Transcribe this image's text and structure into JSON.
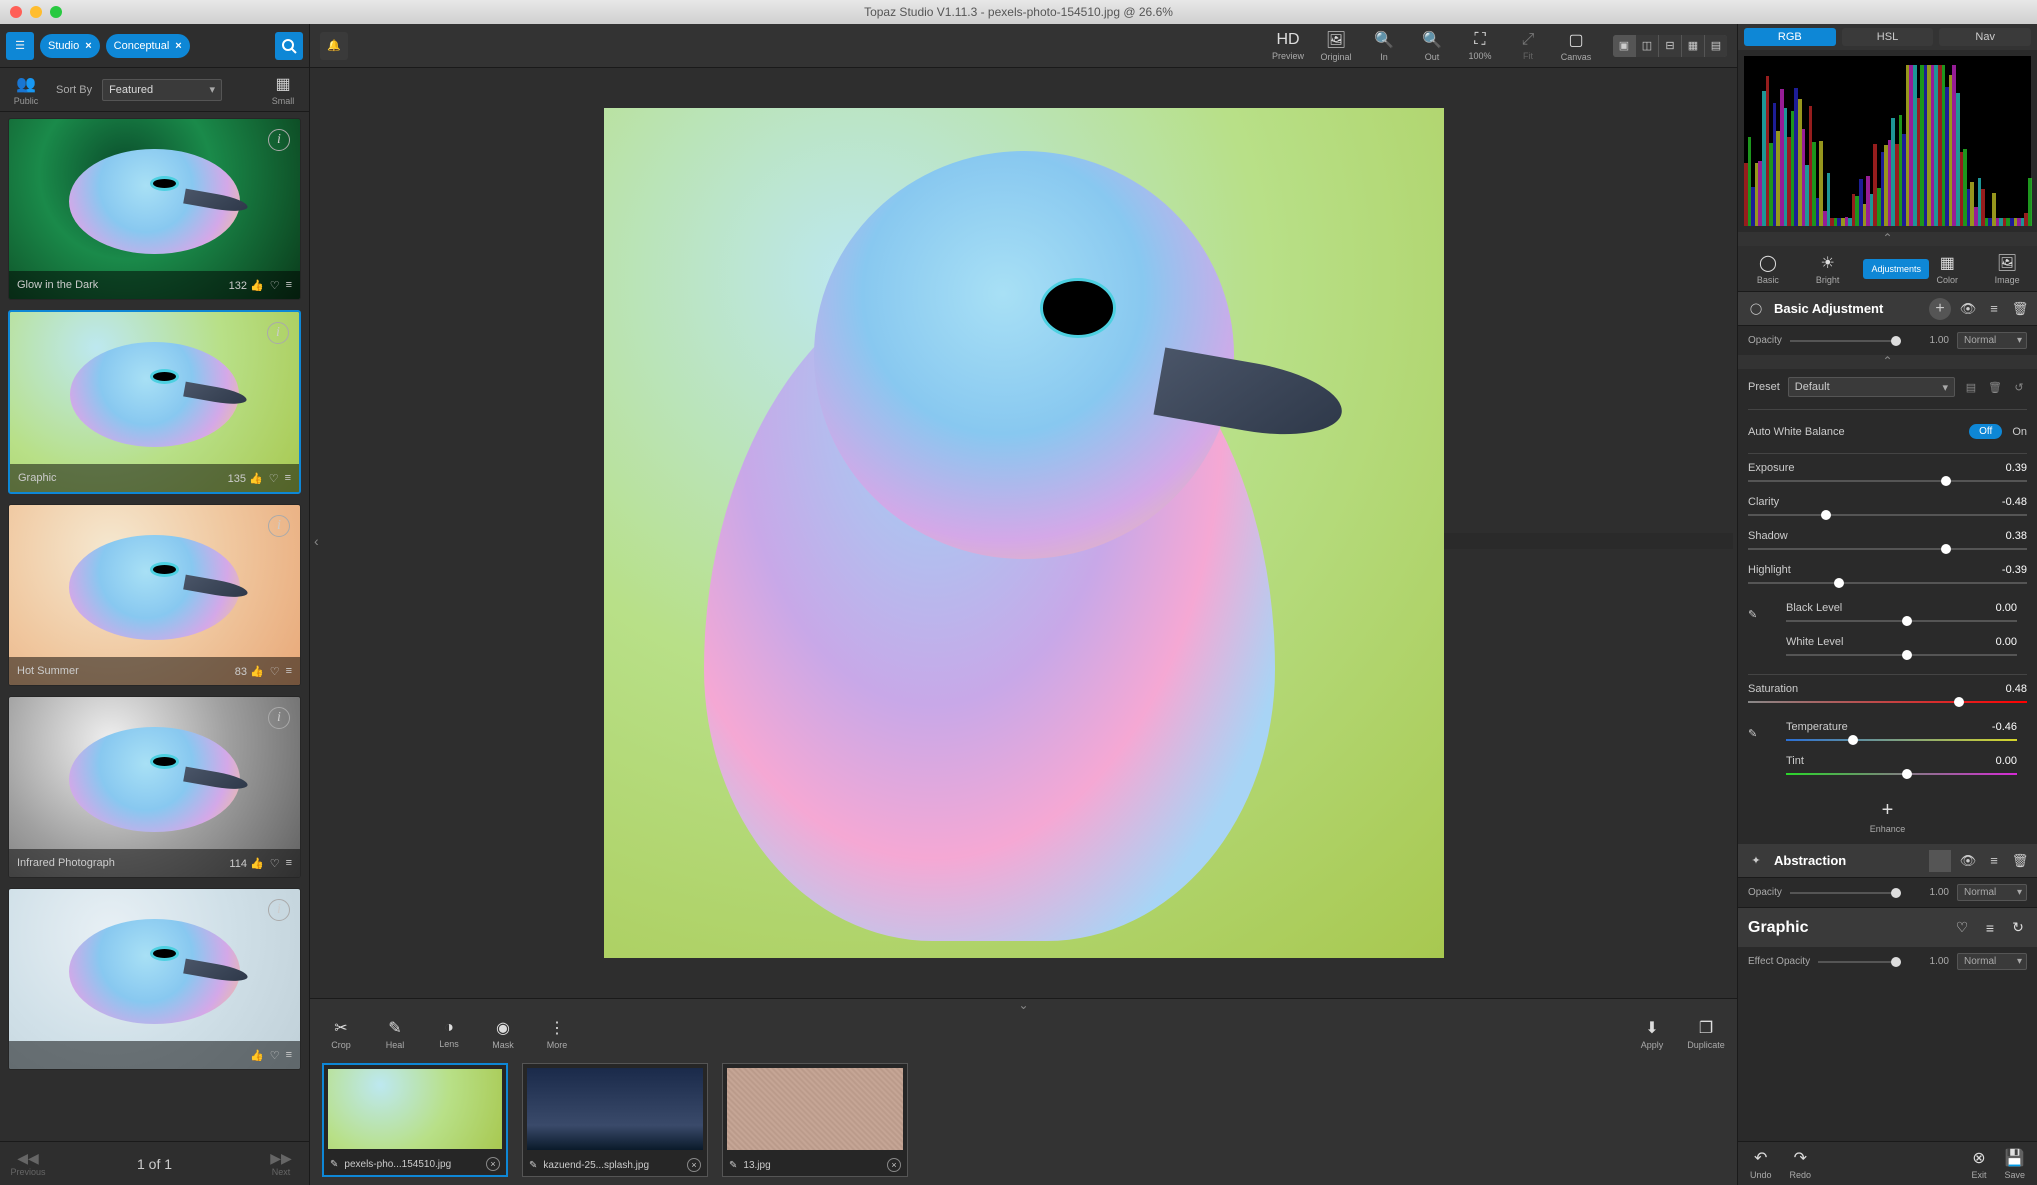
{
  "window": {
    "title": "Topaz Studio V1.11.3 - pexels-photo-154510.jpg @ 26.6%"
  },
  "left": {
    "filters": [
      {
        "name": "studio-filter",
        "label": "Studio"
      },
      {
        "name": "conceptual-filter",
        "label": "Conceptual"
      }
    ],
    "public_label": "Public",
    "small_label": "Small",
    "sort_label": "Sort By",
    "sort_value": "Featured",
    "presets": [
      {
        "name": "Glow in the Dark",
        "likes": "132",
        "selected": false
      },
      {
        "name": "Graphic",
        "likes": "135",
        "selected": true
      },
      {
        "name": "Hot Summer",
        "likes": "83",
        "selected": false
      },
      {
        "name": "Infrared Photograph",
        "likes": "114",
        "selected": false
      },
      {
        "name": "",
        "likes": "",
        "selected": false
      }
    ],
    "pager": {
      "prev": "Previous",
      "next": "Next",
      "text": "1 of 1"
    }
  },
  "toolbar": {
    "preview": "Preview",
    "original": "Original",
    "in": "In",
    "out": "Out",
    "pct": "100%",
    "fit": "Fit",
    "canvas": "Canvas",
    "crop": "Crop",
    "heal": "Heal",
    "lens": "Lens",
    "mask": "Mask",
    "more": "More",
    "apply": "Apply",
    "duplicate": "Duplicate"
  },
  "filmstrip": [
    {
      "name": "pexels-pho...154510.jpg",
      "selected": true
    },
    {
      "name": "kazuend-25...splash.jpg",
      "selected": false
    },
    {
      "name": "13.jpg",
      "selected": false
    }
  ],
  "histogram": {
    "tabs": [
      "RGB",
      "HSL",
      "Nav"
    ],
    "active": "RGB"
  },
  "modes": {
    "basic": "Basic",
    "bright": "Bright",
    "adjustments": "Adjustments",
    "color": "Color",
    "image": "Image"
  },
  "adjustment": {
    "title": "Basic Adjustment",
    "opacity_label": "Opacity",
    "opacity": "1.00",
    "blend": "Normal",
    "preset_label": "Preset",
    "preset_value": "Default",
    "awb_label": "Auto White Balance",
    "awb_off": "Off",
    "awb_on": "On",
    "params": {
      "exposure": {
        "label": "Exposure",
        "value": "0.39",
        "pos": 69
      },
      "clarity": {
        "label": "Clarity",
        "value": "-0.48",
        "pos": 26
      },
      "shadow": {
        "label": "Shadow",
        "value": "0.38",
        "pos": 69
      },
      "highlight": {
        "label": "Highlight",
        "value": "-0.39",
        "pos": 31
      },
      "black": {
        "label": "Black Level",
        "value": "0.00",
        "pos": 50
      },
      "white": {
        "label": "White Level",
        "value": "0.00",
        "pos": 50
      },
      "saturation": {
        "label": "Saturation",
        "value": "0.48",
        "pos": 74
      },
      "temperature": {
        "label": "Temperature",
        "value": "-0.46",
        "pos": 27
      },
      "tint": {
        "label": "Tint",
        "value": "0.00",
        "pos": 50
      }
    },
    "enhance": "Enhance"
  },
  "abstraction": {
    "title": "Abstraction",
    "opacity_label": "Opacity",
    "opacity": "1.00",
    "blend": "Normal"
  },
  "effect": {
    "title": "Graphic",
    "opacity_label": "Effect Opacity",
    "opacity": "1.00",
    "blend": "Normal"
  },
  "actions": {
    "undo": "Undo",
    "redo": "Redo",
    "exit": "Exit",
    "save": "Save"
  }
}
